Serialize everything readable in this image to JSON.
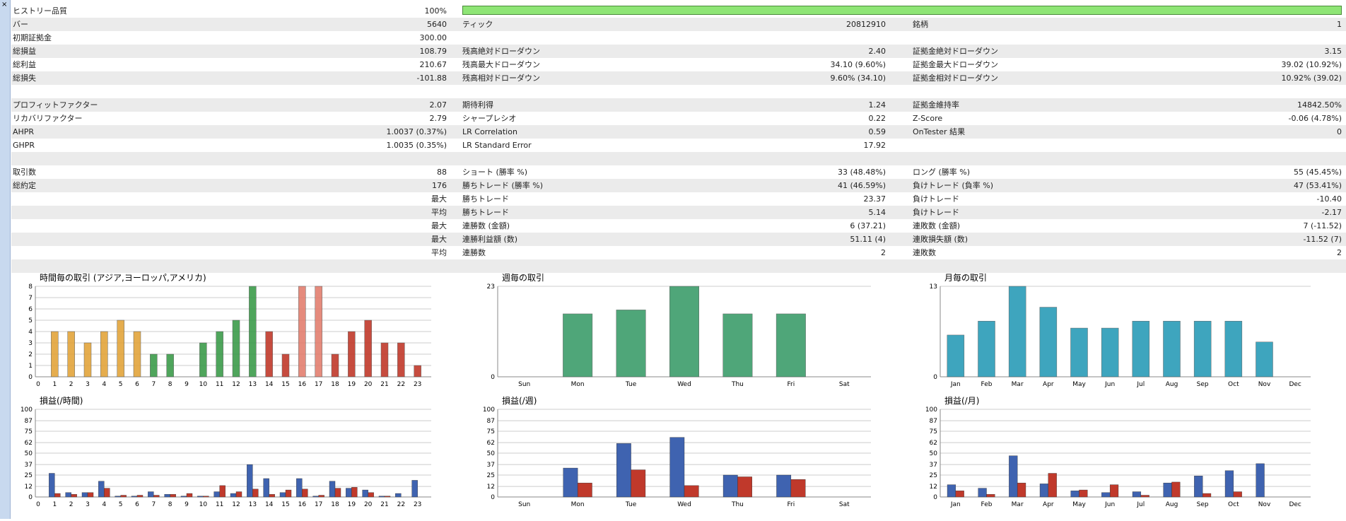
{
  "panel": {
    "close_glyph": "×"
  },
  "summary": {
    "history_quality_label": "ヒストリー品質",
    "history_quality_value": "100%",
    "history_quality_fill": 1.0,
    "rows": [
      [
        "バー",
        "5640",
        "ティック",
        "20812910",
        "銘柄",
        "1"
      ],
      [
        "初期証拠金",
        "300.00",
        "",
        "",
        "",
        ""
      ],
      [
        "総損益",
        "108.79",
        "残高絶対ドローダウン",
        "2.40",
        "証拠金絶対ドローダウン",
        "3.15"
      ],
      [
        "総利益",
        "210.67",
        "残高最大ドローダウン",
        "34.10 (9.60%)",
        "証拠金最大ドローダウン",
        "39.02 (10.92%)"
      ],
      [
        "総損失",
        "-101.88",
        "残高相対ドローダウン",
        "9.60% (34.10)",
        "証拠金相対ドローダウン",
        "10.92% (39.02)"
      ],
      [
        "",
        "",
        "",
        "",
        "",
        ""
      ],
      [
        "プロフィットファクター",
        "2.07",
        "期待利得",
        "1.24",
        "証拠金維持率",
        "14842.50%"
      ],
      [
        "リカバリファクター",
        "2.79",
        "シャープレシオ",
        "0.22",
        "Z-Score",
        "-0.06 (4.78%)"
      ],
      [
        "AHPR",
        "1.0037 (0.37%)",
        "LR Correlation",
        "0.59",
        "OnTester 結果",
        "0"
      ],
      [
        "GHPR",
        "1.0035 (0.35%)",
        "LR Standard Error",
        "17.92",
        "",
        ""
      ],
      [
        "",
        "",
        "",
        "",
        "",
        ""
      ],
      [
        "取引数",
        "88",
        "ショート (勝率 %)",
        "33 (48.48%)",
        "ロング (勝率 %)",
        "55 (45.45%)"
      ],
      [
        "総約定",
        "176",
        "勝ちトレード (勝率 %)",
        "41 (46.59%)",
        "負けトレード (負率 %)",
        "47 (53.41%)"
      ],
      [
        "",
        "最大",
        "勝ちトレード",
        "23.37",
        "負けトレード",
        "-10.40"
      ],
      [
        "",
        "平均",
        "勝ちトレード",
        "5.14",
        "負けトレード",
        "-2.17"
      ],
      [
        "",
        "最大",
        "連勝数 (金額)",
        "6 (37.21)",
        "連敗数 (金額)",
        "7 (-11.52)"
      ],
      [
        "",
        "最大",
        "連勝利益額 (数)",
        "51.11 (4)",
        "連敗損失額 (数)",
        "-11.52 (7)"
      ],
      [
        "",
        "平均",
        "連勝数",
        "2",
        "連敗数",
        "2"
      ],
      [
        "",
        "",
        "",
        "",
        "",
        ""
      ]
    ]
  },
  "colors": {
    "orange": "#e3a53b",
    "green": "#3d9c4b",
    "salmon": "#e37f70",
    "red_dark": "#c0392b",
    "week_green": "#3d9d6b",
    "month_teal": "#2a9cb7",
    "profit_blue": "#3f63b0",
    "loss_red": "#c0392b",
    "grid": "#cccccc"
  },
  "chart_data": [
    {
      "type": "bar",
      "title": "時間毎の取引 (アジア,ヨーロッパ,アメリカ)",
      "categories": [
        "0",
        "1",
        "2",
        "3",
        "4",
        "5",
        "6",
        "7",
        "8",
        "9",
        "10",
        "11",
        "12",
        "13",
        "14",
        "15",
        "16",
        "17",
        "18",
        "19",
        "20",
        "21",
        "22",
        "23"
      ],
      "values": [
        0,
        4,
        4,
        3,
        4,
        5,
        4,
        2,
        2,
        0,
        3,
        4,
        5,
        8,
        4,
        2,
        8,
        8,
        2,
        4,
        5,
        3,
        3,
        1
      ],
      "yticks": [
        0,
        1,
        2,
        3,
        4,
        5,
        6,
        7,
        8
      ],
      "ylim": [
        0,
        8
      ]
    },
    {
      "type": "bar",
      "title": "週毎の取引",
      "categories": [
        "Sun",
        "Mon",
        "Tue",
        "Wed",
        "Thu",
        "Fri",
        "Sat"
      ],
      "values": [
        0,
        16,
        17,
        23,
        16,
        16,
        0
      ],
      "yticks": [
        0,
        23
      ],
      "ylim": [
        0,
        23
      ]
    },
    {
      "type": "bar",
      "title": "月毎の取引",
      "categories": [
        "Jan",
        "Feb",
        "Mar",
        "Apr",
        "May",
        "Jun",
        "Jul",
        "Aug",
        "Sep",
        "Oct",
        "Nov",
        "Dec"
      ],
      "values": [
        6,
        8,
        13,
        10,
        7,
        7,
        8,
        8,
        8,
        8,
        5,
        0
      ],
      "yticks": [
        0,
        13
      ],
      "ylim": [
        0,
        13
      ]
    },
    {
      "type": "bar",
      "title": "損益(/時間)",
      "categories": [
        "0",
        "1",
        "2",
        "3",
        "4",
        "5",
        "6",
        "7",
        "8",
        "9",
        "10",
        "11",
        "12",
        "13",
        "14",
        "15",
        "16",
        "17",
        "18",
        "19",
        "20",
        "21",
        "22",
        "23"
      ],
      "series": [
        {
          "values": [
            0,
            27,
            5,
            5,
            18,
            1,
            1,
            6,
            3,
            1,
            1,
            6,
            4,
            37,
            21,
            5,
            21,
            1,
            18,
            10,
            8,
            1,
            4,
            19
          ]
        },
        {
          "values": [
            0,
            4,
            3,
            5,
            10,
            2,
            2,
            2,
            3,
            4,
            1,
            13,
            6,
            9,
            3,
            8,
            9,
            2,
            10,
            11,
            5,
            1,
            0,
            0
          ]
        }
      ],
      "yticks": [
        0,
        12,
        25,
        37,
        50,
        62,
        75,
        87,
        100
      ],
      "ylim": [
        0,
        100
      ]
    },
    {
      "type": "bar",
      "title": "損益(/週)",
      "categories": [
        "Sun",
        "Mon",
        "Tue",
        "Wed",
        "Thu",
        "Fri",
        "Sat"
      ],
      "series": [
        {
          "values": [
            0,
            33,
            61,
            68,
            25,
            25,
            0
          ]
        },
        {
          "values": [
            0,
            16,
            31,
            13,
            23,
            20,
            0
          ]
        }
      ],
      "yticks": [
        0,
        12,
        25,
        37,
        50,
        62,
        75,
        87,
        100
      ],
      "ylim": [
        0,
        100
      ]
    },
    {
      "type": "bar",
      "title": "損益(/月)",
      "categories": [
        "Jan",
        "Feb",
        "Mar",
        "Apr",
        "May",
        "Jun",
        "Jul",
        "Aug",
        "Sep",
        "Oct",
        "Nov",
        "Dec"
      ],
      "series": [
        {
          "values": [
            14,
            10,
            47,
            15,
            7,
            5,
            6,
            16,
            24,
            30,
            38,
            0
          ]
        },
        {
          "values": [
            7,
            3,
            16,
            27,
            8,
            14,
            2,
            17,
            4,
            6,
            0,
            0
          ]
        }
      ],
      "yticks": [
        0,
        12,
        25,
        37,
        50,
        62,
        75,
        87,
        100
      ],
      "ylim": [
        0,
        100
      ]
    }
  ]
}
